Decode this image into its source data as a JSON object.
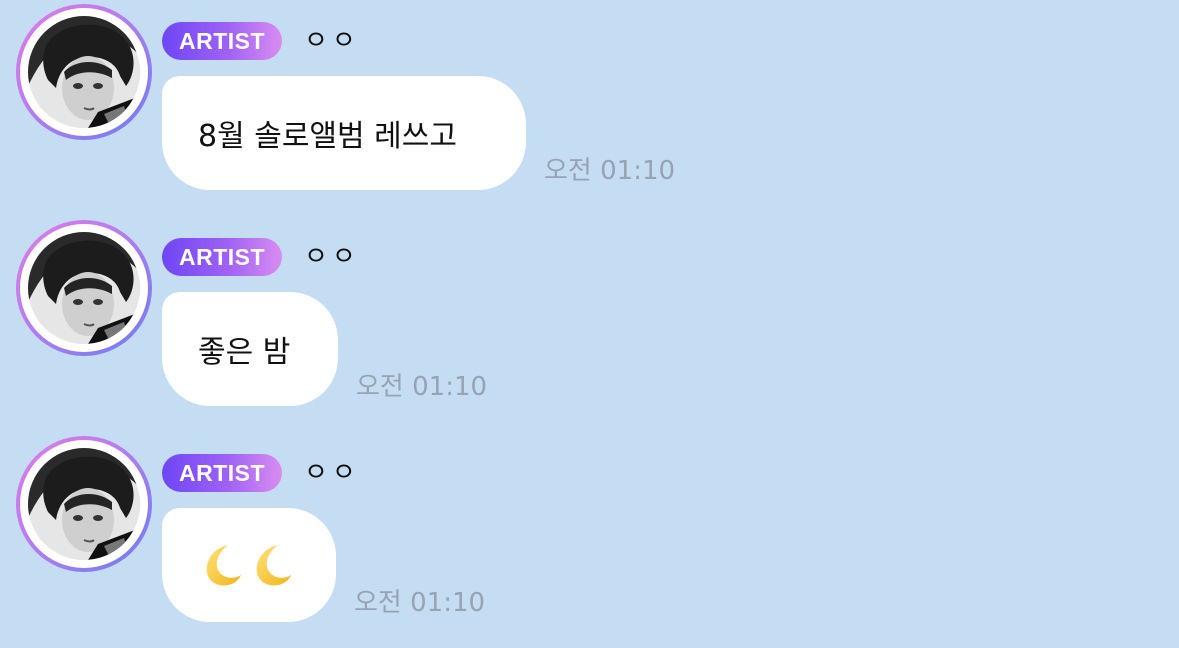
{
  "colors": {
    "background": "#c5ddf2",
    "bubble": "#ffffff",
    "badge_gradient_start": "#6e46f4",
    "badge_gradient_end": "#d98cf0",
    "timestamp": "#97a3b0"
  },
  "messages": [
    {
      "badge": "ARTIST",
      "sender": "ㅇㅇ",
      "text": "8월 솔로앨범 레쓰고",
      "time": "오전 01:10"
    },
    {
      "badge": "ARTIST",
      "sender": "ㅇㅇ",
      "text": "좋은 밤",
      "time": "오전 01:10"
    },
    {
      "badge": "ARTIST",
      "sender": "ㅇㅇ",
      "text": "",
      "emoji": [
        "crescent-moon-icon",
        "crescent-moon-icon"
      ],
      "time": "오전 01:10"
    }
  ]
}
